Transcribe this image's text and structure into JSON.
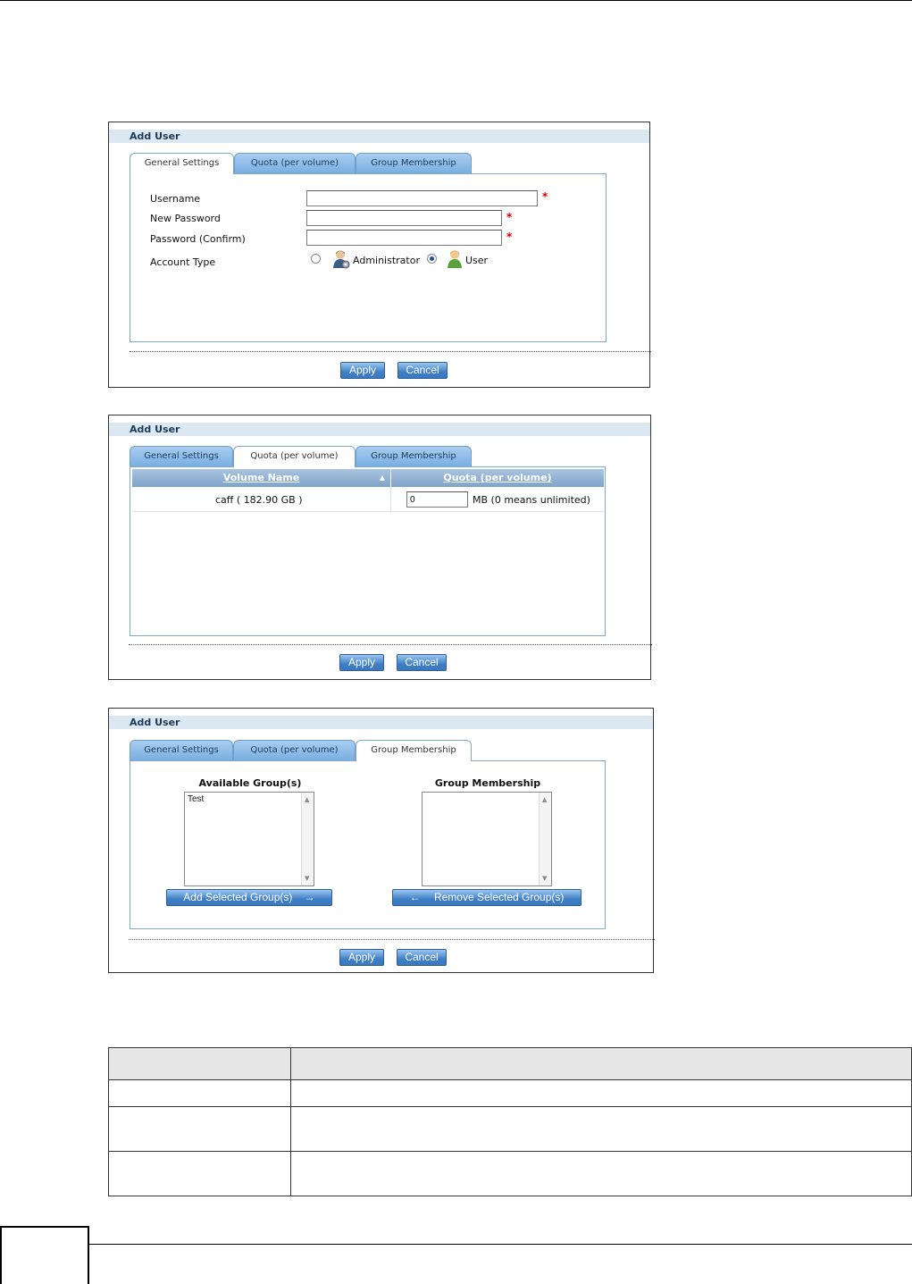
{
  "dialog1": {
    "title": "Add User",
    "tabs": [
      "General Settings",
      "Quota (per volume)",
      "Group Membership"
    ],
    "active_tab": "General Settings",
    "fields": {
      "username_label": "Username",
      "new_password_label": "New Password",
      "password_confirm_label": "Password (Confirm)",
      "account_type_label": "Account Type",
      "username_value": "",
      "new_password_value": "",
      "password_confirm_value": "",
      "required_mark": "*"
    },
    "account_types": [
      {
        "label": "Administrator",
        "selected": false,
        "icon": "admin-user-icon"
      },
      {
        "label": "User",
        "selected": true,
        "icon": "user-icon"
      }
    ],
    "apply_label": "Apply",
    "cancel_label": "Cancel"
  },
  "dialog2": {
    "title": "Add User",
    "tabs": [
      "General Settings",
      "Quota (per volume)",
      "Group Membership"
    ],
    "active_tab": "Quota (per volume)",
    "columns": [
      "Volume Name",
      "Quota (per volume)"
    ],
    "rows": [
      {
        "volume": "caff ( 182.90 GB )",
        "quota_value": "0",
        "quota_unit": "MB (0 means unlimited)"
      }
    ],
    "sort_icon": "sort-up-icon",
    "apply_label": "Apply",
    "cancel_label": "Cancel"
  },
  "dialog3": {
    "title": "Add User",
    "tabs": [
      "General Settings",
      "Quota (per volume)",
      "Group Membership"
    ],
    "active_tab": "Group Membership",
    "available_title": "Available Group(s)",
    "available_items": [
      "Test"
    ],
    "membership_title": "Group Membership",
    "membership_items": [],
    "add_button": "Add Selected Group(s)",
    "add_arrow": "→",
    "remove_button": "Remove Selected Group(s)",
    "remove_arrow": "←",
    "apply_label": "Apply",
    "cancel_label": "Cancel"
  },
  "colors": {
    "accent": "#3f7fc6",
    "title_bar": "#dbe8f2",
    "required": "#d00000"
  }
}
